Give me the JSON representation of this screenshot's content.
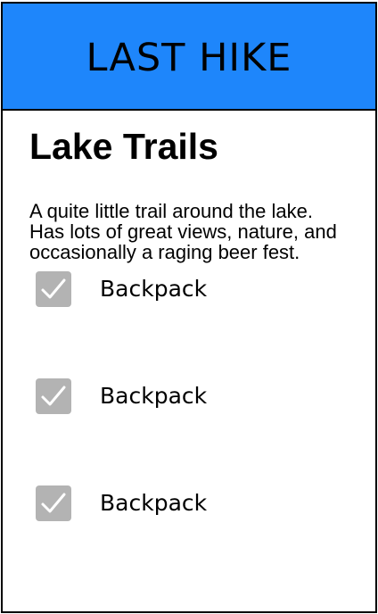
{
  "header": {
    "title": "LAST HIKE"
  },
  "trail": {
    "name": "Lake Trails",
    "description": "A quite little trail around the lake. Has lots of great views, nature, and occasionally a raging beer fest."
  },
  "checklist": {
    "items": [
      {
        "label": "Backpack",
        "checked": true
      },
      {
        "label": "Backpack",
        "checked": true
      },
      {
        "label": "Backpack",
        "checked": true
      }
    ]
  },
  "colors": {
    "header_bg": "#1e86fb",
    "checkbox_bg": "#b3b3b3",
    "checkmark": "#ffffff"
  },
  "icons": {
    "checkbox": "checkmark-icon"
  }
}
